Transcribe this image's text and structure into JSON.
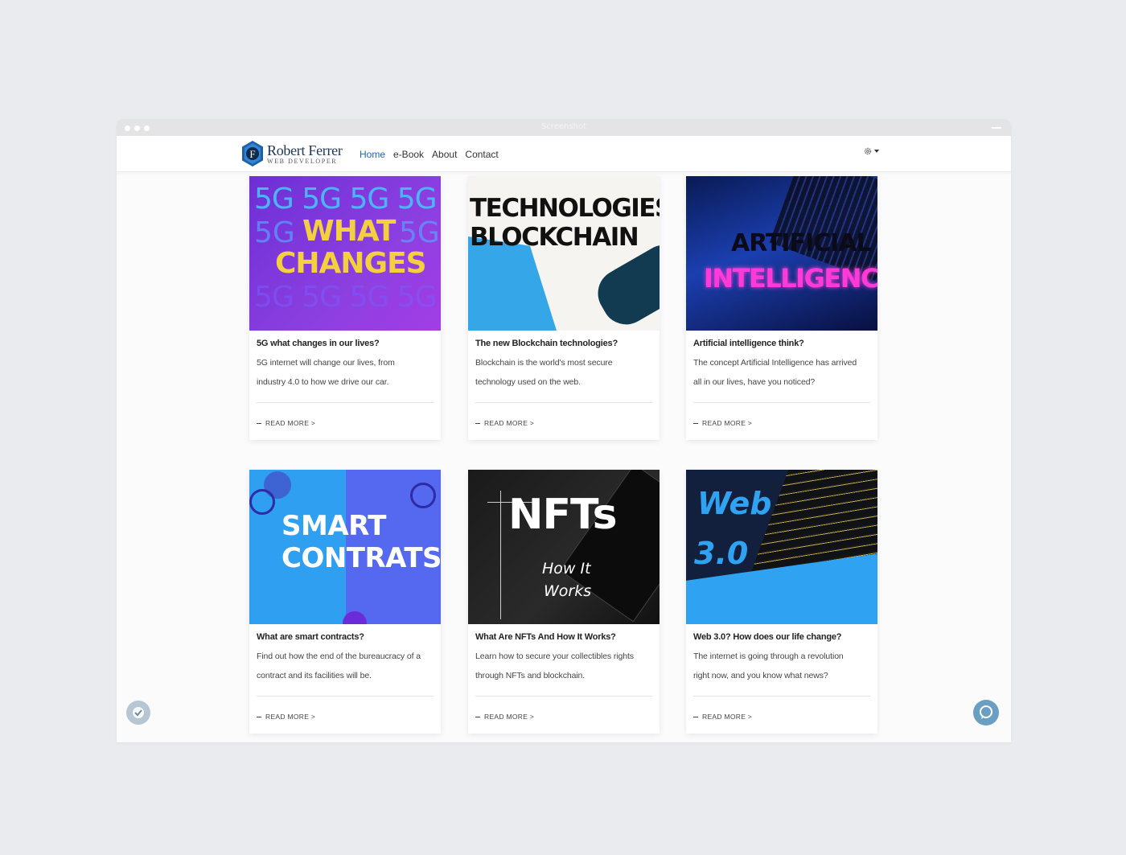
{
  "browser": {
    "title": "Screenshot"
  },
  "brand": {
    "name": "Robert Ferrer",
    "tagline": "WEB DEVELOPER",
    "badge_letter": "F"
  },
  "nav": {
    "home": "Home",
    "ebook": "e-Book",
    "about": "About",
    "contact": "Contact"
  },
  "settings_icon": "gear-icon",
  "read_more": "READ MORE >",
  "cards": [
    {
      "image_text": [
        "5G 5G 5G 5G",
        "WHAT",
        "CHANGES"
      ],
      "title": "5G what changes in our lives?",
      "desc1": "5G internet will change our lives, from",
      "desc2": "industry 4.0 to how we drive our car."
    },
    {
      "image_text": [
        "TECHNOLOGIES",
        "BLOCKCHAIN"
      ],
      "title": "The new Blockchain technologies?",
      "desc1": "Blockchain is the world's most secure",
      "desc2": "technology used on the web."
    },
    {
      "image_text": [
        "ARTIFICIAL",
        "INTELLIGENCE"
      ],
      "title": "Artificial intelligence think?",
      "desc1": "The concept Artificial Intelligence has arrived",
      "desc2": "all in our lives, have you noticed?"
    },
    {
      "image_text": [
        "SMART",
        "CONTRATS"
      ],
      "title": "What are smart contracts?",
      "desc1": "Find out how the end of the bureaucracy of a",
      "desc2": "contract and its facilities will be."
    },
    {
      "image_text": [
        "NFTs",
        "How It",
        "Works"
      ],
      "title": "What Are NFTs And How It Works?",
      "desc1": "Learn how to secure your collectibles rights",
      "desc2": "through NFTs and blockchain."
    },
    {
      "image_text": [
        "Web",
        "3.0"
      ],
      "title": "Web 3.0? How does our life change?",
      "desc1": "The internet is going through a revolution",
      "desc2": "right now, and you know what news?"
    }
  ],
  "colors": {
    "accent": "#1e63b5",
    "brand": "#1d3557"
  }
}
